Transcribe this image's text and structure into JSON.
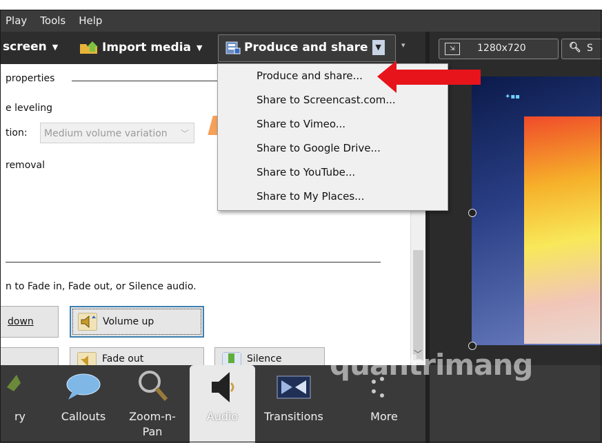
{
  "menubar": {
    "items": [
      "Play",
      "Tools",
      "Help"
    ]
  },
  "toolbar": {
    "record_screen": "screen",
    "import_media": "Import media",
    "produce_share": "Produce and share",
    "resolution": "1280x720",
    "search_partial": "S"
  },
  "dropdown": {
    "items": [
      "Produce and share...",
      "Share to Screencast.com...",
      "Share to Vimeo...",
      "Share to Google Drive...",
      "Share to YouTube...",
      "Share to My Places..."
    ]
  },
  "properties": {
    "header": "properties",
    "volume_leveling": "e leveling",
    "variation_label": "tion:",
    "variation_value": "Medium volume variation",
    "noise_removal": "removal",
    "hint": "n to Fade in, Fade out, or Silence audio.",
    "buttons": {
      "volume_down": "down",
      "volume_up": "Volume up",
      "fade_out": "Fade out",
      "silence": "Silence"
    }
  },
  "tabs": [
    {
      "label": "ry"
    },
    {
      "label": "Callouts"
    },
    {
      "label": "Zoom-n-\nPan"
    },
    {
      "label": "Audio"
    },
    {
      "label": "Transitions"
    },
    {
      "label": "More"
    }
  ],
  "watermark": "quantrimang",
  "colors": {
    "accent_red": "#e8141b",
    "toolbar_bg": "#2d2d2d",
    "focus_blue": "#3c7fb1"
  }
}
